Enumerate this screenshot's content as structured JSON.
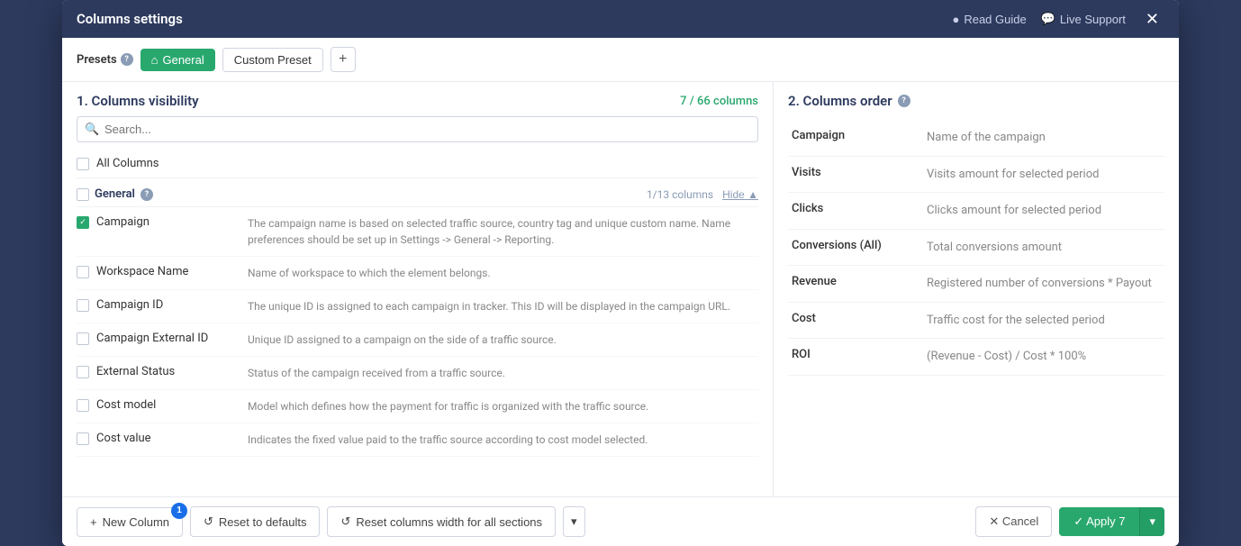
{
  "modal": {
    "title": "Columns settings",
    "header_actions": {
      "read_guide": "Read Guide",
      "live_support": "Live Support"
    }
  },
  "presets": {
    "label": "Presets",
    "general_label": "General",
    "custom_label": "Custom Preset",
    "add_tooltip": "+"
  },
  "left_panel": {
    "title": "1. Columns visibility",
    "count_label": "7 / 66 columns",
    "search_placeholder": "Search...",
    "all_columns_label": "All Columns",
    "section": {
      "name": "General",
      "count": "1/13 columns",
      "hide_label": "Hide ▲"
    },
    "columns": [
      {
        "name": "Campaign",
        "checked": true,
        "desc": "The campaign name is based on selected traffic source, country tag and unique custom name. Name preferences should be set up in Settings -> General -> Reporting."
      },
      {
        "name": "Workspace Name",
        "checked": false,
        "desc": "Name of workspace to which the element belongs."
      },
      {
        "name": "Campaign ID",
        "checked": false,
        "desc": "The unique ID is assigned to each campaign in tracker. This ID will be displayed in the campaign URL."
      },
      {
        "name": "Campaign External ID",
        "checked": false,
        "desc": "Unique ID assigned to a campaign on the side of a traffic source."
      },
      {
        "name": "External Status",
        "checked": false,
        "desc": "Status of the campaign received from a traffic source."
      },
      {
        "name": "Cost model",
        "checked": false,
        "desc": "Model which defines how the payment for traffic is organized with the traffic source."
      },
      {
        "name": "Cost value",
        "checked": false,
        "desc": "Indicates the fixed value paid to the traffic source according to cost model selected."
      }
    ]
  },
  "right_panel": {
    "title": "2. Columns order",
    "items": [
      {
        "name": "Campaign",
        "desc": "Name of the campaign"
      },
      {
        "name": "Visits",
        "desc": "Visits amount for selected period"
      },
      {
        "name": "Clicks",
        "desc": "Clicks amount for selected period"
      },
      {
        "name": "Conversions (All)",
        "desc": "Total conversions amount"
      },
      {
        "name": "Revenue",
        "desc": "Registered number of conversions * Payout"
      },
      {
        "name": "Cost",
        "desc": "Traffic cost for the selected period"
      },
      {
        "name": "ROI",
        "desc": "(Revenue - Cost) / Cost * 100%"
      }
    ]
  },
  "footer": {
    "new_column_label": "New Column",
    "new_column_badge": "1",
    "reset_defaults_label": "Reset to defaults",
    "reset_width_label": "Reset columns width for all sections",
    "cancel_label": "✕ Cancel",
    "apply_label": "✓ Apply 7"
  }
}
